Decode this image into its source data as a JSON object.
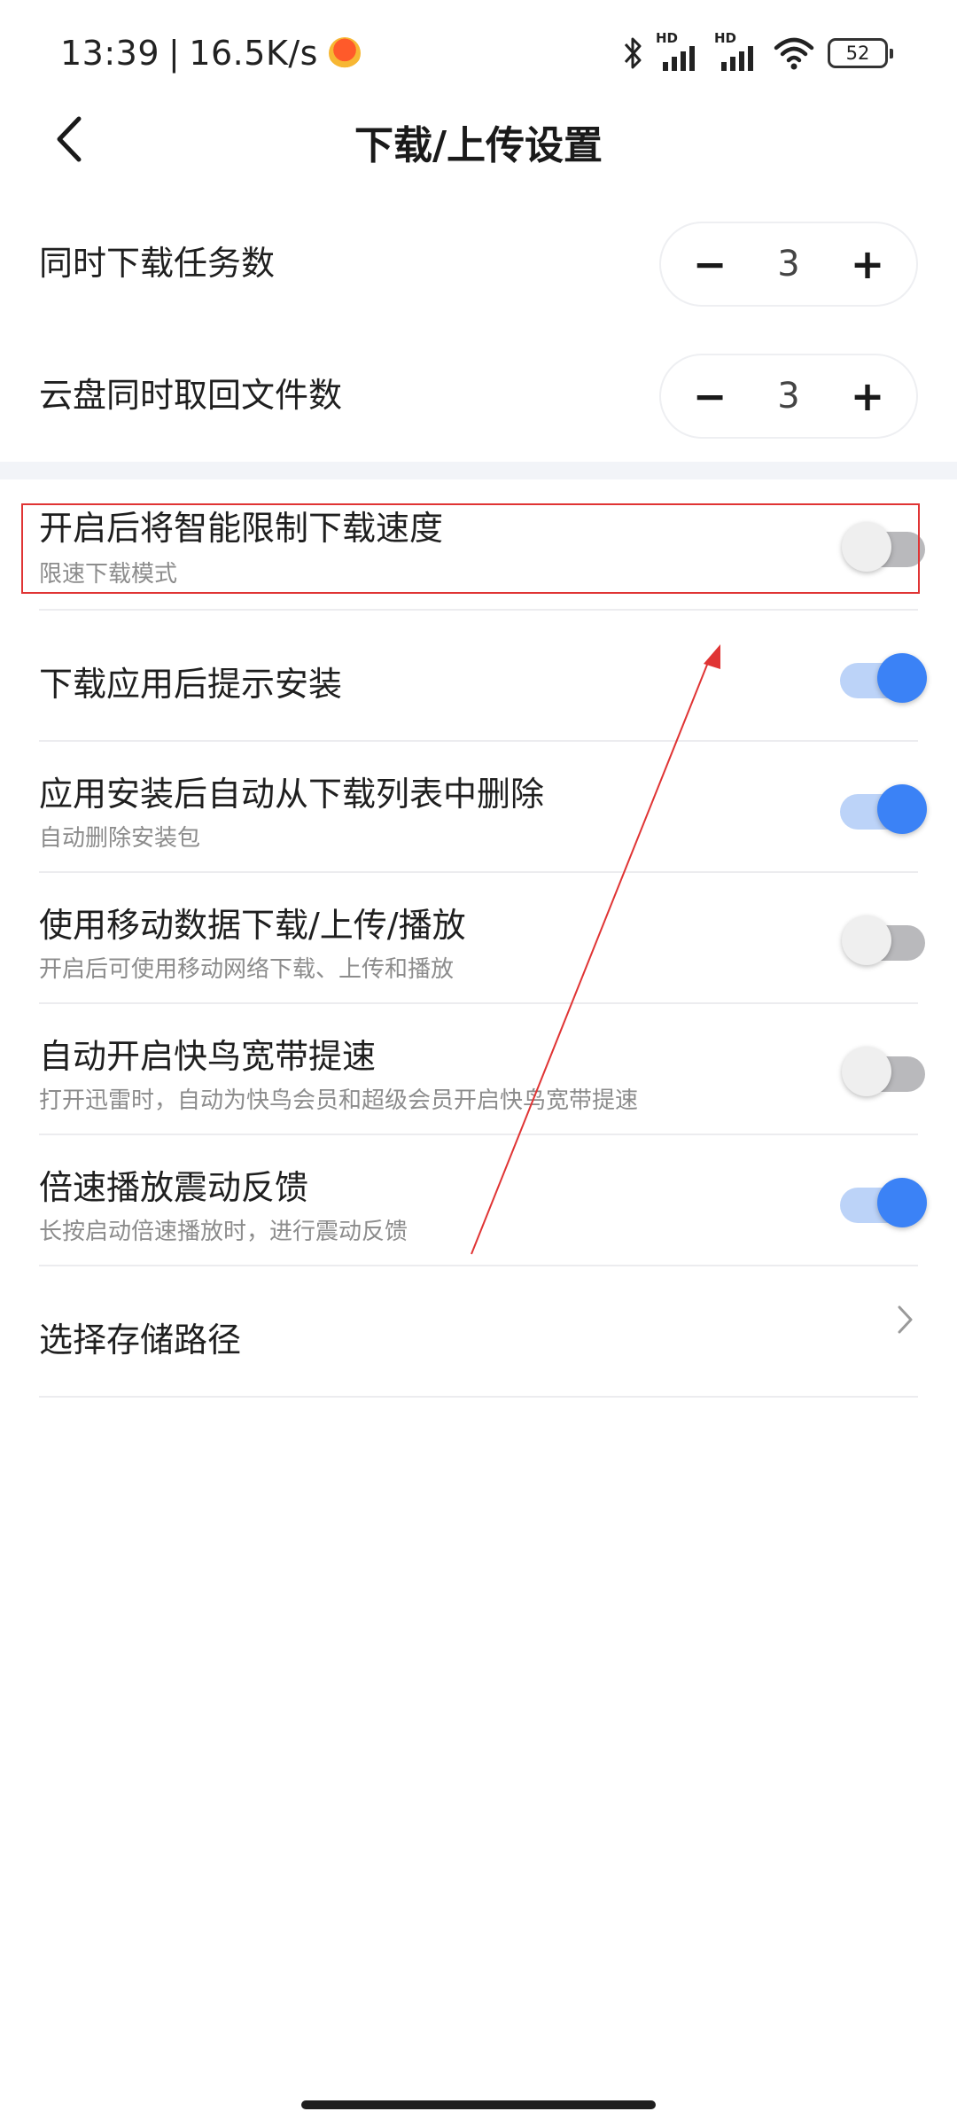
{
  "status_bar": {
    "time": "13:39",
    "separator": "|",
    "net_speed": "16.5K/s",
    "sim1_label": "HD",
    "sim2_label": "HD",
    "battery": "52",
    "icons": [
      "notification-app-icon",
      "bluetooth-icon",
      "signal-icon",
      "signal-icon",
      "wifi-icon",
      "battery-icon"
    ]
  },
  "header": {
    "title": "下载/上传设置",
    "back_icon": "chevron-left-icon"
  },
  "steppers": [
    {
      "label": "同时下载任务数",
      "value": "3",
      "minus": "−",
      "plus": "+"
    },
    {
      "label": "云盘同时取回文件数",
      "value": "3",
      "minus": "−",
      "plus": "+"
    }
  ],
  "settings": [
    {
      "title": "开启后将智能限制下载速度",
      "subtitle": "限速下载模式",
      "enabled": false
    },
    {
      "title": "下载应用后提示安装",
      "subtitle": "",
      "enabled": true
    },
    {
      "title": "应用安装后自动从下载列表中删除",
      "subtitle": "自动删除安装包",
      "enabled": true
    },
    {
      "title": "使用移动数据下载/上传/播放",
      "subtitle": "开启后可使用移动网络下载、上传和播放",
      "enabled": false
    },
    {
      "title": "自动开启快鸟宽带提速",
      "subtitle": "打开迅雷时，自动为快鸟会员和超级会员开启快鸟宽带提速",
      "enabled": false
    },
    {
      "title": "倍速播放震动反馈",
      "subtitle": "长按启动倍速播放时，进行震动反馈",
      "enabled": true
    }
  ],
  "storage_path": {
    "label": "选择存储路径",
    "icon": "chevron-right-icon"
  },
  "colors": {
    "accent": "#3b82f6",
    "toggle_on_track": "#bcd3f8",
    "toggle_off_track": "#b9b9bc",
    "annotation_red": "#e03434",
    "section_gap": "#f2f4f8"
  }
}
